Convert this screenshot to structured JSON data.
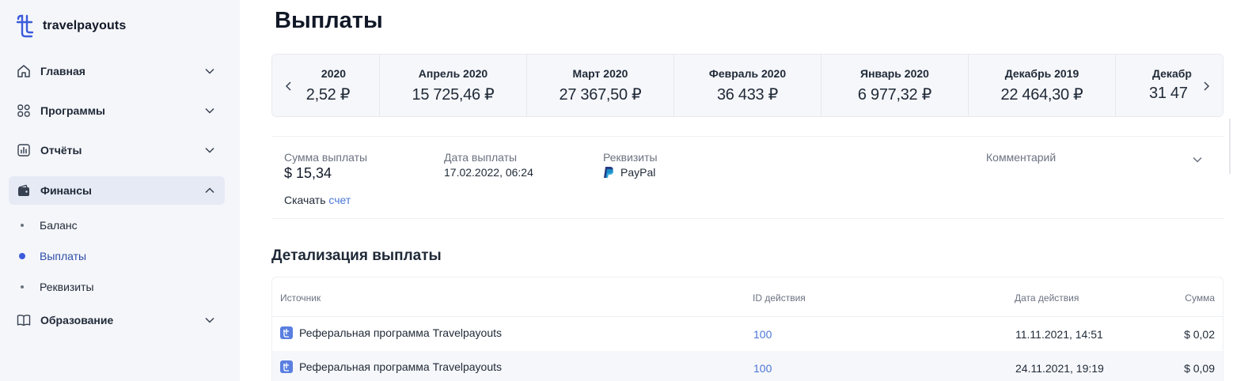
{
  "brand": {
    "name": "travelpayouts"
  },
  "sidebar": {
    "items": [
      {
        "label": "Главная",
        "icon": "home-icon"
      },
      {
        "label": "Программы",
        "icon": "grid-icon"
      },
      {
        "label": "Отчёты",
        "icon": "chart-icon"
      },
      {
        "label": "Финансы",
        "icon": "wallet-icon",
        "expanded": true
      },
      {
        "label": "Образование",
        "icon": "book-icon"
      }
    ],
    "finance_sub": [
      {
        "label": "Баланс"
      },
      {
        "label": "Выплаты",
        "active": true
      },
      {
        "label": "Реквизиты"
      }
    ]
  },
  "page": {
    "title": "Выплаты"
  },
  "months": [
    {
      "label": "2020",
      "value": "2,52 ₽"
    },
    {
      "label": "Апрель 2020",
      "value": "15 725,46 ₽"
    },
    {
      "label": "Март 2020",
      "value": "27 367,50 ₽"
    },
    {
      "label": "Февраль 2020",
      "value": "36 433 ₽"
    },
    {
      "label": "Январь 2020",
      "value": "6 977,32 ₽"
    },
    {
      "label": "Декабрь 2019",
      "value": "22 464,30 ₽"
    },
    {
      "label": "Декабр",
      "value": "31 47"
    }
  ],
  "payout": {
    "amount_label": "Сумма выплаты",
    "amount": "$ 15,34",
    "date_label": "Дата выплаты",
    "date": "17.02.2022, 06:24",
    "requisites_label": "Реквизиты",
    "method": "PayPal",
    "comment_label": "Комментарий",
    "download_text": "Скачать",
    "download_link": "счет"
  },
  "details": {
    "title": "Детализация выплаты",
    "columns": {
      "source": "Источник",
      "id": "ID действия",
      "date": "Дата действия",
      "sum": "Сумма"
    },
    "rows": [
      {
        "source": "Реферальная программа Travelpayouts",
        "id": "100",
        "date": "11.11.2021, 14:51",
        "sum": "$ 0,02"
      },
      {
        "source": "Реферальная программа Travelpayouts",
        "id": "100",
        "date": "24.11.2021, 19:19",
        "sum": "$ 0,09"
      }
    ]
  },
  "colors": {
    "accent": "#3b5bdb",
    "link": "#4a76d8",
    "sidebar_bg": "#f5f6fa",
    "active_bg": "#e6eaf5"
  }
}
